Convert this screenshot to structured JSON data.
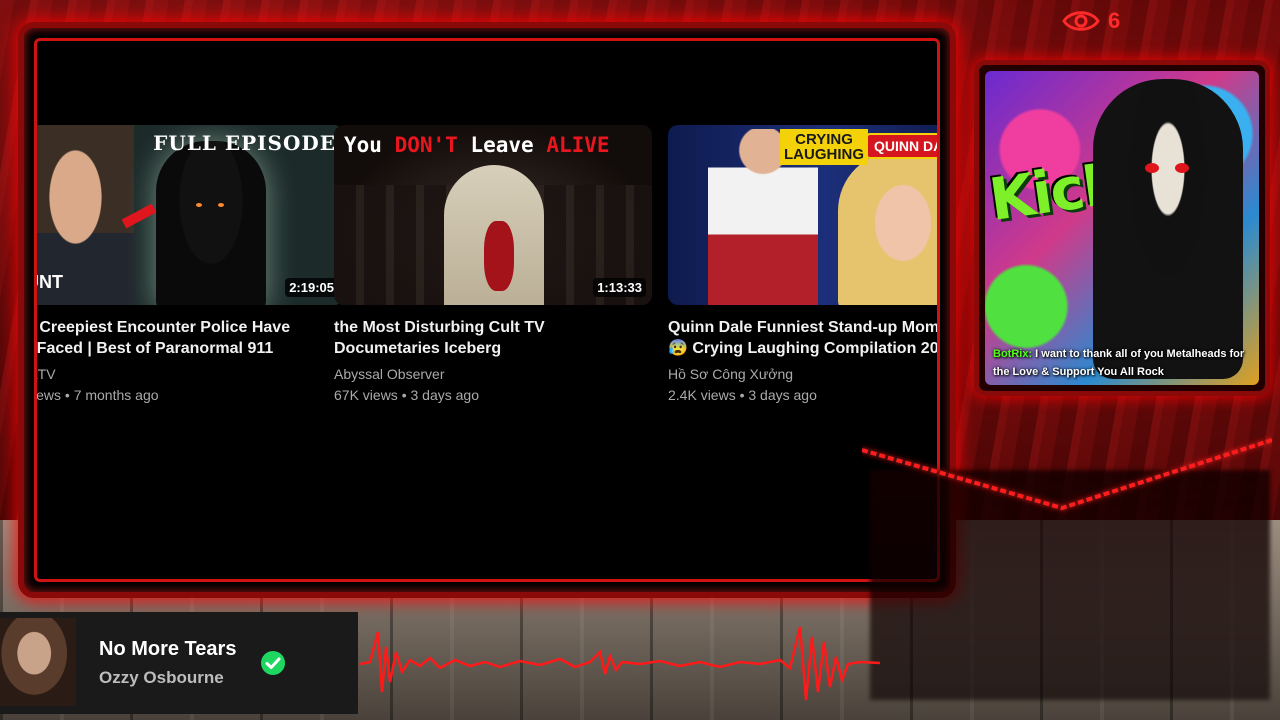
{
  "overlay": {
    "viewer_count": "6",
    "viewer_icon": "eye-icon"
  },
  "videos": [
    {
      "title": "e Creepiest Encounter Police Have\nr Faced | Best of Paranormal 911",
      "channel": "ntTV",
      "meta": "views • 7 months ago",
      "duration": "2:19:05",
      "thumb_text": "FULL EPISODE",
      "thumb_logo": "UNT"
    },
    {
      "title": "the Most Disturbing Cult TV\nDocumetaries Iceberg",
      "channel": "Abyssal Observer",
      "meta": "67K views • 3 days ago",
      "duration": "1:13:33",
      "thumb_text_1": "You ",
      "thumb_text_2": "DON'T",
      "thumb_text_3": " Leave ",
      "thumb_text_4": "ALIVE"
    },
    {
      "title": "Quinn Dale Funniest Stand-up Mom\n😰 Crying Laughing Compilation 20",
      "channel": "Hồ Sơ Công Xưởng",
      "meta": "2.4K views • 3 days ago",
      "thumb_badge_1": "CRYING\nLAUGHING",
      "thumb_badge_2": "QUINN DA"
    }
  ],
  "side_panel": {
    "art_text": "KicK F",
    "chat_user": "BotRix:",
    "chat_message": " I want to thank all of you Metalheads for the Love & Support You All Rock"
  },
  "now_playing": {
    "title": "No More Tears",
    "artist": "Ozzy Osbourne",
    "status_icon": "check-circle-icon"
  },
  "colors": {
    "accent_red": "#ff1e1e",
    "check_green": "#1ed760",
    "bot_green": "#53fc18"
  }
}
